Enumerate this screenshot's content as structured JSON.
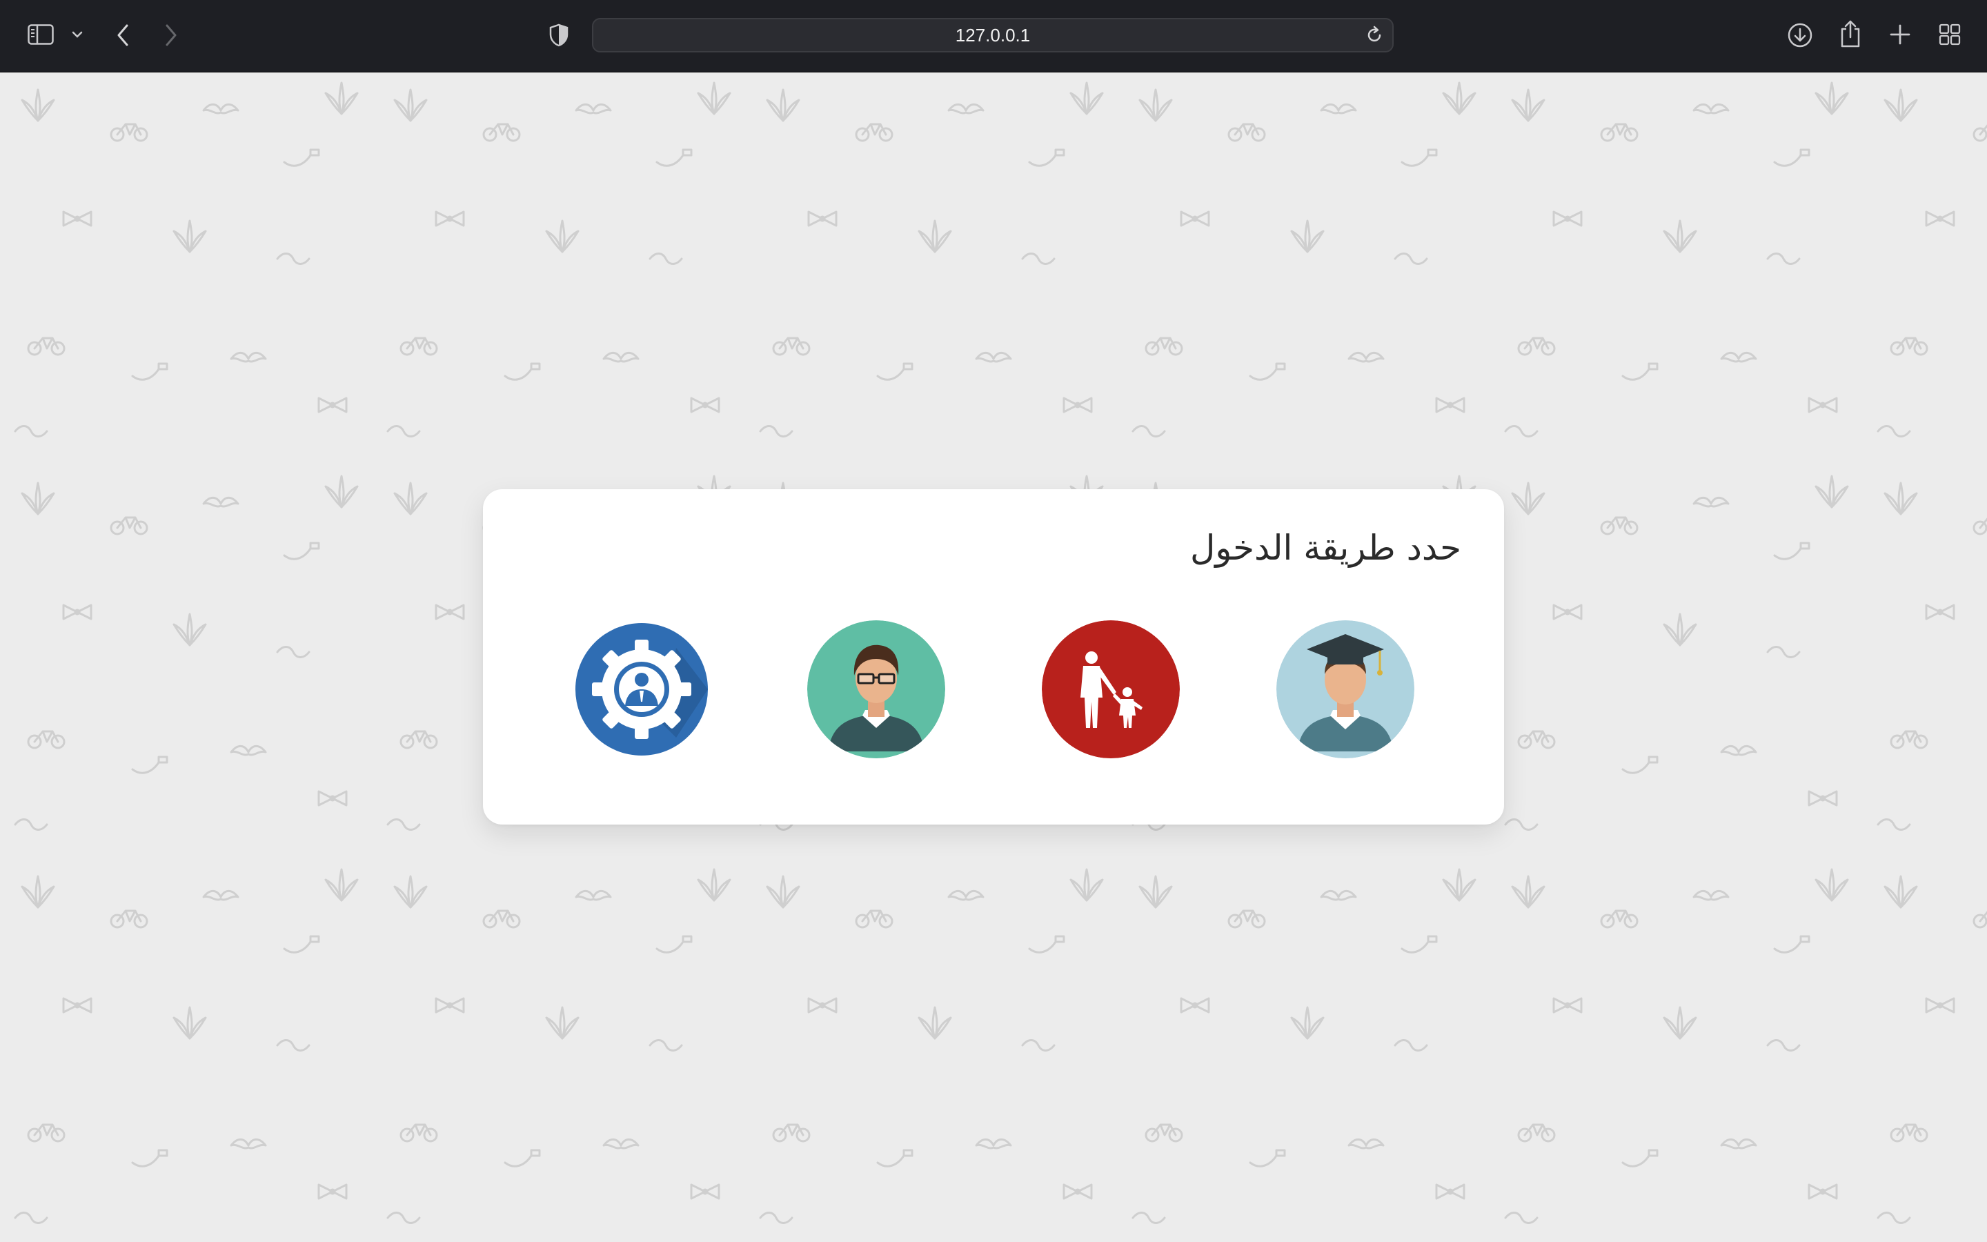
{
  "browser": {
    "url": "127.0.0.1"
  },
  "login": {
    "title": "حدد طريقة الدخول",
    "roles": [
      {
        "id": "student",
        "icon": "student-graduate-icon",
        "color": "#aed3df"
      },
      {
        "id": "parent",
        "icon": "parent-child-icon",
        "color": "#b8211c"
      },
      {
        "id": "teacher",
        "icon": "teacher-glasses-icon",
        "color": "#5fbea4"
      },
      {
        "id": "admin",
        "icon": "admin-gear-icon",
        "color": "#2f6db3"
      }
    ]
  },
  "colors": {
    "page_background": "#ececec",
    "toolbar": "#1e1f24",
    "card": "#ffffff"
  }
}
